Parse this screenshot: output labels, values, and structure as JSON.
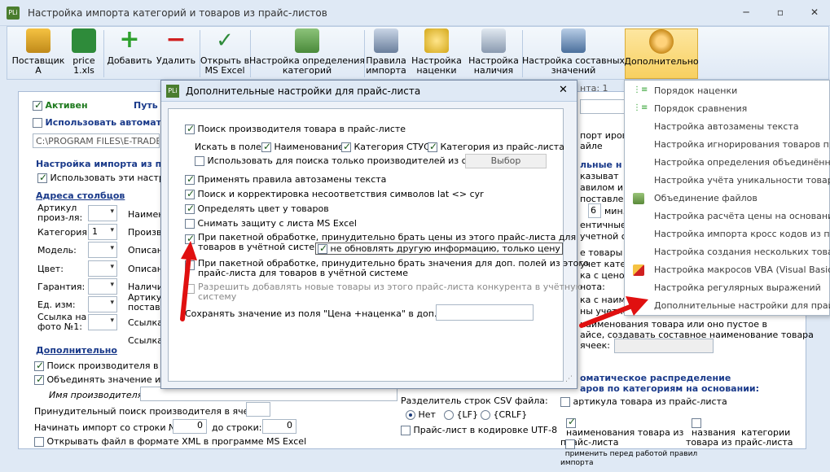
{
  "window": {
    "title": "Настройка импорта категорий и товаров из прайс-листов",
    "app_icon": "PLi"
  },
  "ribbon": {
    "buttons": [
      {
        "label": "Поставщик\nА",
        "has_arrow": true
      },
      {
        "label": "price\n1.xls",
        "has_arrow": true
      },
      {
        "label": "Добавить",
        "has_arrow": true
      },
      {
        "label": "Удалить"
      },
      {
        "label": "Открыть в\nMS Excel"
      },
      {
        "label": "Настройка определения\nкатегорий"
      },
      {
        "label": "Правила\nимпорта"
      },
      {
        "label": "Настройка\nнаценки"
      },
      {
        "label": "Настройка\nналичия"
      },
      {
        "label": "Настройка составных\nзначений"
      },
      {
        "label": "Дополнительно"
      }
    ]
  },
  "main": {
    "active_label": "Активен",
    "path_label": "Путь",
    "use_auto_label": "Использовать автомат",
    "path_value": "C:\\PROGRAM FILES\\E-TRADE PR",
    "import_settings_title": "Настройка импорта из про",
    "use_these_label": "Использовать эти настрой",
    "columns_title": "Адреса столбцов",
    "col_rows": [
      {
        "label": "Артикул\nпроиз-ля:",
        "value": "",
        "right": "Наимен"
      },
      {
        "label": "Категория:",
        "value": "1",
        "right": "Произв"
      },
      {
        "label": "Модель:",
        "value": "",
        "right": "Описан"
      },
      {
        "label": "Цвет:",
        "value": "",
        "right": "Описан"
      },
      {
        "label": "Гарантия:",
        "value": "",
        "right": "Наличи"
      },
      {
        "label": "Ед. изм:",
        "value": "",
        "right": "Артику\nпостав"
      },
      {
        "label": "Ссылка на\nфото №1:",
        "value": "",
        "right": "Ссылка"
      }
    ],
    "right_extra": "Ссылка",
    "additional_title": "Дополнительно",
    "search_mfr_label": "Поиск производителя в",
    "merge_label": "Объединять значение из п",
    "mfr_name_label": "Имя производителя:",
    "forced_search_label": "Принудительный поиск производителя в ячейке:",
    "start_row_label": "Начинать импорт со строки №:",
    "start_row_value": "0",
    "to_row_label": "до строки:",
    "to_row_value": "0",
    "xml_label": "Открывать файл в формате XML в программе MS Excel",
    "csv_sep_label": "Разделитель строк CSV файла:",
    "csv_opts": [
      "Нет",
      "{LF}",
      "{CRLF}"
    ],
    "utf8_label": "Прайс-лист в кодировке UTF-8",
    "right_col": {
      "count_label": "нта: 1",
      "lines": [
        "порт ирован",
        "айле",
        "льные н",
        "казыват",
        "авилом им",
        "поставлен",
        "ентичные",
        "учетной сис",
        "е товары в",
        "учет катего",
        "ка с ценой",
        "нота:",
        "ка с наимен",
        "ны учетной с"
      ],
      "min_label": "мин. с",
      "min_value": "6",
      "name_line1": "наименования товара или оно пустое в",
      "name_line2": "айсе, создавать составное наименование товара",
      "name_line3": "ячеек:",
      "auto_dist_title": "оматическое распределение",
      "auto_dist_title2": "аров по категориям на основании:",
      "by_article": "артикула товара из прайс-листа",
      "by_name": "наименования товара из\nпрайс-листа",
      "by_cat_name": "названия  категории\nтовара из прайс-листа",
      "apply_rules": "применить перед работой правил\nимпорта"
    }
  },
  "dialog": {
    "title": "Дополнительные настройки для прайс-листа",
    "icon": "PLi",
    "search_mfr": "Поиск производителя товара в прайс-листе",
    "search_in": "Искать в поле:",
    "f_name": "Наименование",
    "f_cat": "Категория СТУС",
    "f_cat_price": "Категория из прайс-листа",
    "only_list": "Использовать для поиска только производителей из списка",
    "choose_btn": "Выбор",
    "autoreplace": "Применять правила автозамены текста",
    "latcyr": "Поиск и корректировка несоответствия символов lat <> cyr",
    "color": "Определять цвет у товаров",
    "unprotect": "Снимать защиту с листа MS Excel",
    "batch_price": "При пакетной обработке, принудительно брать цены из этого прайс-листа для\nтоваров в учётной системе",
    "no_update": "не обновлять другую информацию, только цену",
    "batch_extra": "При пакетной обработке, принудительно брать значения для доп. полей из этого\nпрайс-листа для товаров в учётной системе",
    "allow_new": "Разрешить добавлять новые товары из этого прайс-листа конкурента в учётную\nсистему",
    "save_value": "Сохранять значение из поля \"Цена +наценка\" в доп. поле:"
  },
  "menu": {
    "items": [
      "Порядок наценки",
      "Порядок сравнения",
      "Настройка автозамены текста",
      "Настройка игнорирования товаров при",
      "Настройка определения объединённых",
      "Настройка учёта уникальности товаров",
      "Объединение файлов",
      "Настройка расчёта цены на основании с",
      "Настройка импорта кросс кодов из прай",
      "Настройка создания нескольких товаров",
      "Настройка макросов VBA (Visual Basic fo",
      "Настройка регулярных выражений",
      "Дополнительные настройки для прайс-л"
    ]
  },
  "colors": {
    "accent": "#1a3a8a",
    "arrow": "#e01010",
    "highlight": "#fde6a0"
  }
}
